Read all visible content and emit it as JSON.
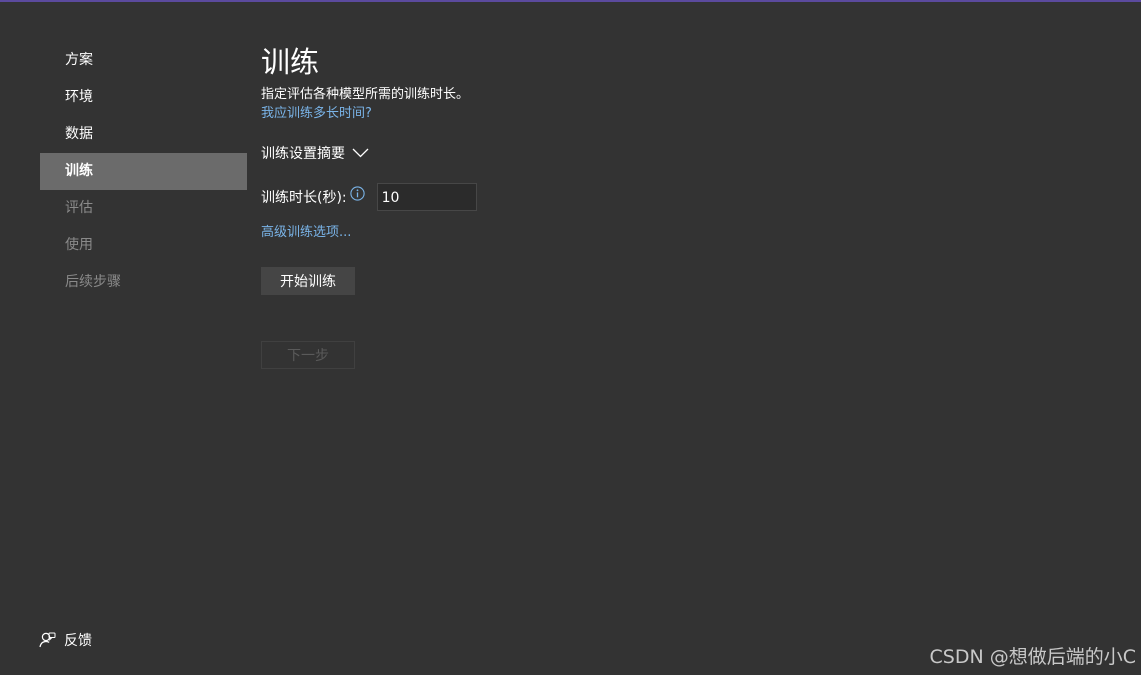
{
  "sidebar": {
    "items": [
      {
        "label": "方案",
        "state": "normal"
      },
      {
        "label": "环境",
        "state": "normal"
      },
      {
        "label": "数据",
        "state": "normal"
      },
      {
        "label": "训练",
        "state": "active"
      },
      {
        "label": "评估",
        "state": "disabled"
      },
      {
        "label": "使用",
        "state": "disabled"
      },
      {
        "label": "后续步骤",
        "state": "disabled"
      }
    ],
    "feedback_label": "反馈",
    "feedback_icon": "feedback-person-icon"
  },
  "main": {
    "title": "训练",
    "description": "指定评估各种模型所需的训练时长。",
    "help_link": "我应训练多长时间?",
    "summary_label": "训练设置摘要",
    "summary_icon": "chevron-down-icon",
    "duration_label": "训练时长(秒):",
    "duration_info_icon": "info-icon",
    "duration_value": "10",
    "advanced_link": "高级训练选项...",
    "start_button": "开始训练",
    "next_button": "下一步"
  },
  "watermark": "CSDN @想做后端的小C",
  "colors": {
    "background": "#333333",
    "accent_bar": "#5b4a9e",
    "link": "#7ab4e8",
    "active_nav": "#6b6b6b",
    "disabled_text": "#8a8a8a"
  }
}
